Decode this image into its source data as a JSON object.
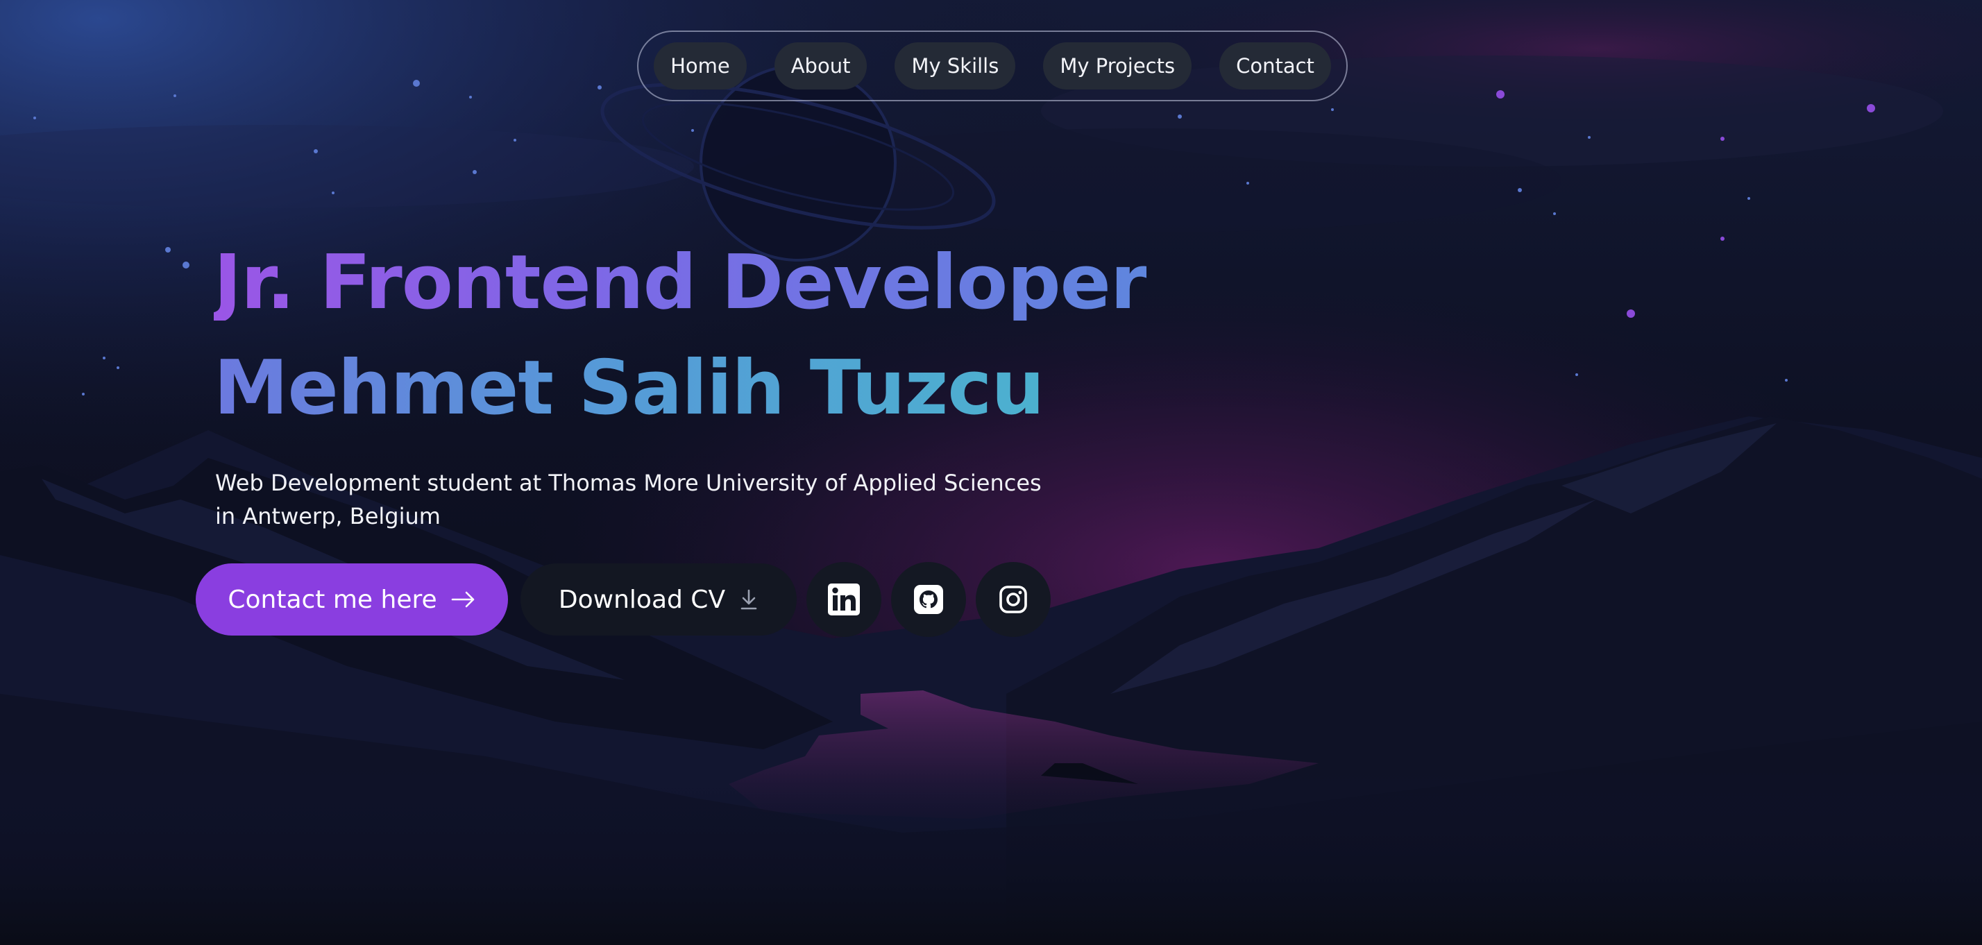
{
  "nav": {
    "items": [
      {
        "label": "Home"
      },
      {
        "label": "About"
      },
      {
        "label": "My Skills"
      },
      {
        "label": "My Projects"
      },
      {
        "label": "Contact"
      }
    ]
  },
  "hero": {
    "title": "Jr. Frontend Developer",
    "name": "Mehmet Salih Tuzcu",
    "subtitle": "Web Development student at Thomas More University of Applied Sciences in Antwerp, Belgium"
  },
  "actions": {
    "contact_label": "Contact me here",
    "contact_icon": "arrow-right-icon",
    "cv_label": "Download CV",
    "cv_icon": "download-icon"
  },
  "social": [
    {
      "icon": "linkedin-icon"
    },
    {
      "icon": "github-icon"
    },
    {
      "icon": "instagram-icon"
    }
  ],
  "colors": {
    "accent": "#8a3ee0",
    "background": "#0b0d18",
    "nav_pill": "#242a36",
    "button_dark": "#131722"
  }
}
